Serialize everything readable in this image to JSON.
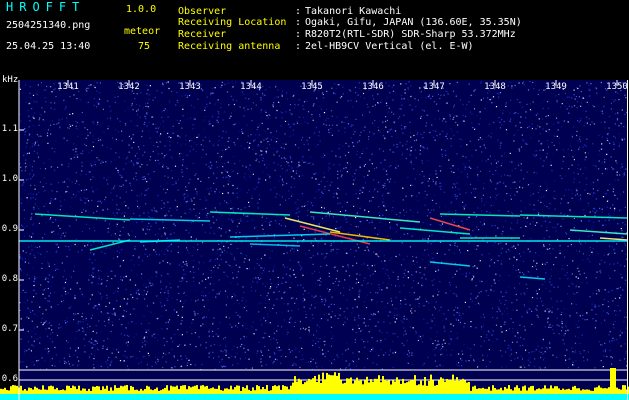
{
  "header": {
    "app_name": "HROFFT",
    "version": "1.0.0",
    "file_name": "2504251340.png",
    "meteor_label": "meteor",
    "timestamp": "25.04.25 13:40",
    "meteor_count": "75"
  },
  "info": [
    {
      "label": "Observer",
      "value": "Takanori Kawachi"
    },
    {
      "label": "Receiving Location",
      "value": "Ogaki, Gifu, JAPAN (136.60E, 35.35N)"
    },
    {
      "label": "Receiver",
      "value": "R820T2(RTL-SDR) SDR-Sharp 53.372MHz"
    },
    {
      "label": "Receiving antenna",
      "value": "2el-HB9CV Vertical (el. E-W)"
    }
  ],
  "y_axis": {
    "unit": "kHz",
    "ticks": [
      "1.1",
      "1.0",
      "0.9",
      "0.8",
      "0.7",
      "0.6"
    ]
  },
  "x_axis": {
    "ticks": [
      "1341",
      "1342",
      "1343",
      "1344",
      "1345",
      "1346",
      "1347",
      "1348",
      "1349",
      "1350"
    ]
  },
  "colors": {
    "background_noise": "#000080",
    "carrier": "#00ffff",
    "meteor_head": "#ff3333",
    "histogram": "#ffff00",
    "axis_text": "#ffffff",
    "header_text": "#ffff00",
    "app_name": "#00ffff"
  }
}
